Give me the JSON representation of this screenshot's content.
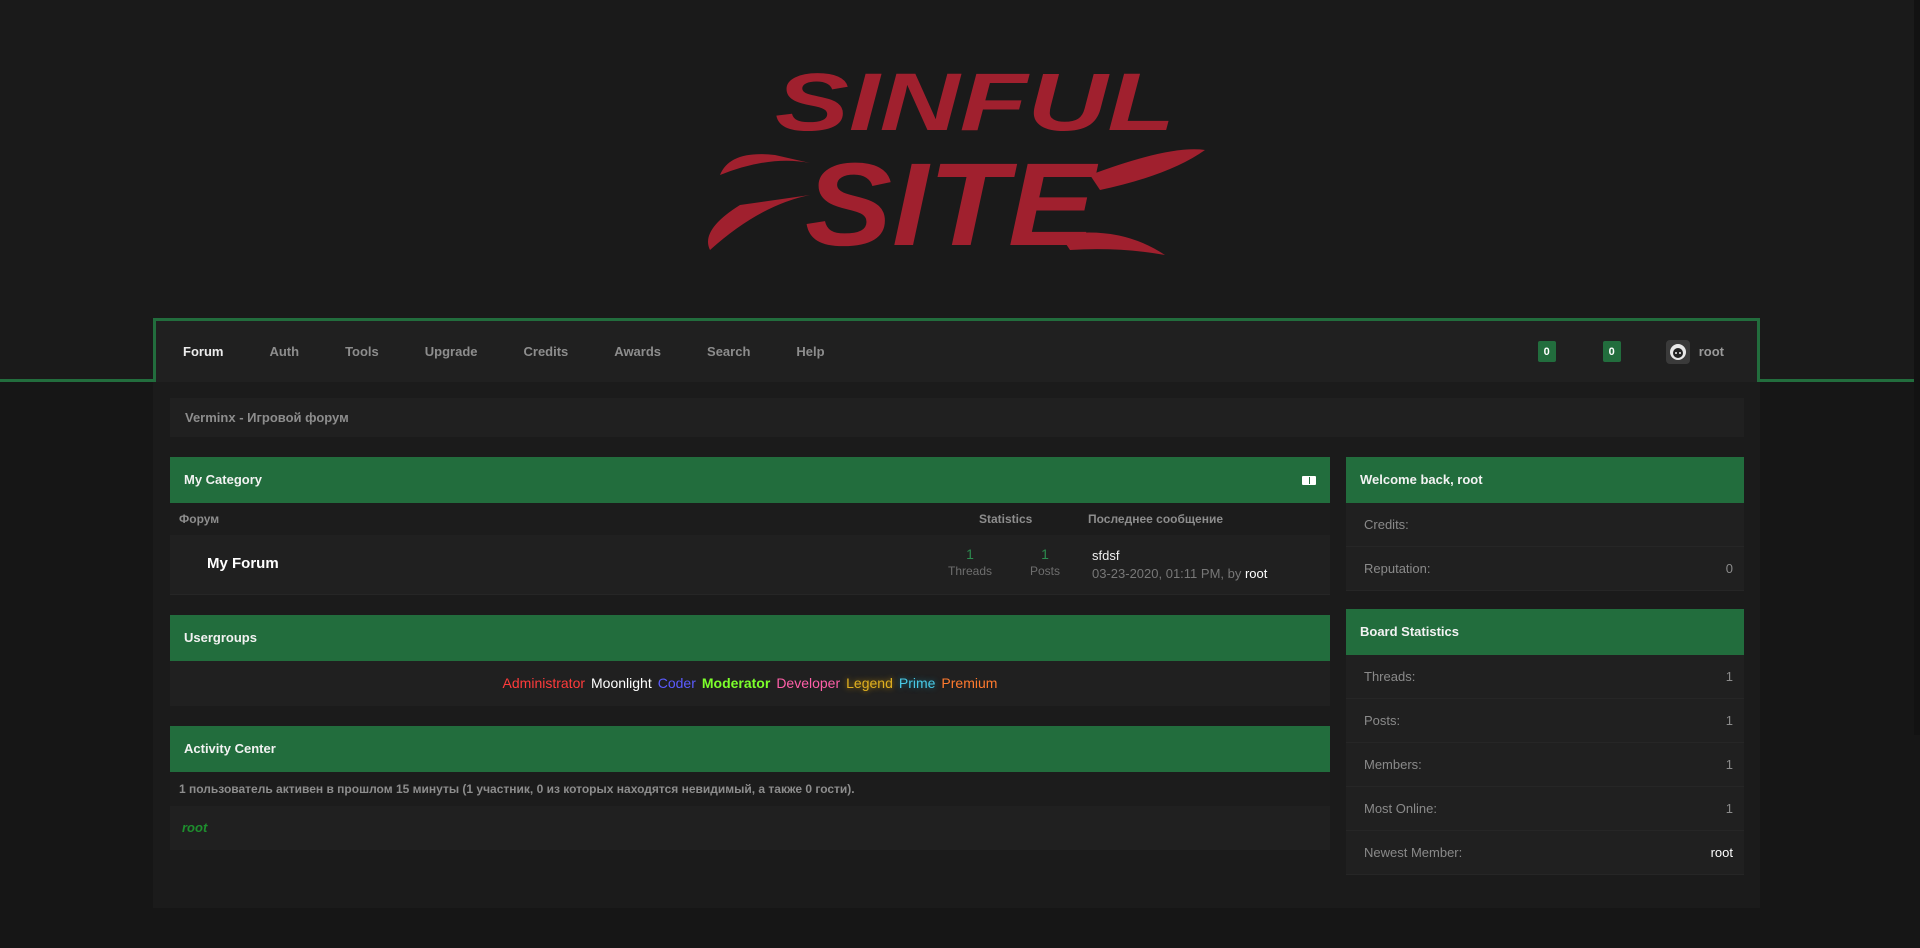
{
  "logo": {
    "line1": "SINFUL",
    "line2": "SITE"
  },
  "nav": {
    "items": [
      {
        "label": "Forum",
        "active": true
      },
      {
        "label": "Auth"
      },
      {
        "label": "Tools"
      },
      {
        "label": "Upgrade"
      },
      {
        "label": "Credits"
      },
      {
        "label": "Awards"
      },
      {
        "label": "Search"
      },
      {
        "label": "Help"
      }
    ],
    "badge1": "0",
    "badge2": "0",
    "username": "root"
  },
  "breadcrumb": "Verminx - Игровой форум",
  "category": {
    "title": "My Category",
    "col_forum": "Форум",
    "col_stats": "Statistics",
    "col_last": "Последнее сообщение",
    "forum_name": "My Forum",
    "threads_num": "1",
    "threads_label": "Threads",
    "posts_num": "1",
    "posts_label": "Posts",
    "last_title": "sfdsf",
    "last_date": "03-23-2020, 01:11 PM, by ",
    "last_by": "root"
  },
  "usergroups": {
    "title": "Usergroups",
    "groups": [
      {
        "name": "Administrator",
        "color": "#ff3b3b"
      },
      {
        "name": "Moonlight",
        "color": "#ffffff"
      },
      {
        "name": "Coder",
        "color": "#5b5bff"
      },
      {
        "name": "Moderator",
        "color": "#7cff2b"
      },
      {
        "name": "Developer",
        "color": "#ff5fa8"
      },
      {
        "name": "Legend",
        "color": "#e0b020"
      },
      {
        "name": "Prime",
        "color": "#49c9e6"
      },
      {
        "name": "Premium",
        "color": "#ff7a2e"
      }
    ]
  },
  "activity": {
    "title": "Activity Center",
    "info": "1 пользователь активен в прошлом 15 минуты (1 участник, 0 из которых находятся невидимый, а также 0 гости).",
    "user": "root"
  },
  "welcome": {
    "title": "Welcome back, root",
    "credits_label": "Credits:",
    "credits_value": "",
    "rep_label": "Reputation:",
    "rep_value": "0"
  },
  "board_stats": {
    "title": "Board Statistics",
    "rows": [
      {
        "label": "Threads:",
        "value": "1"
      },
      {
        "label": "Posts:",
        "value": "1"
      },
      {
        "label": "Members:",
        "value": "1"
      },
      {
        "label": "Most Online:",
        "value": "1"
      },
      {
        "label": "Newest Member:",
        "value": "root"
      }
    ]
  },
  "colors": {
    "accent": "#226d3d",
    "logo": "#a0202e"
  }
}
